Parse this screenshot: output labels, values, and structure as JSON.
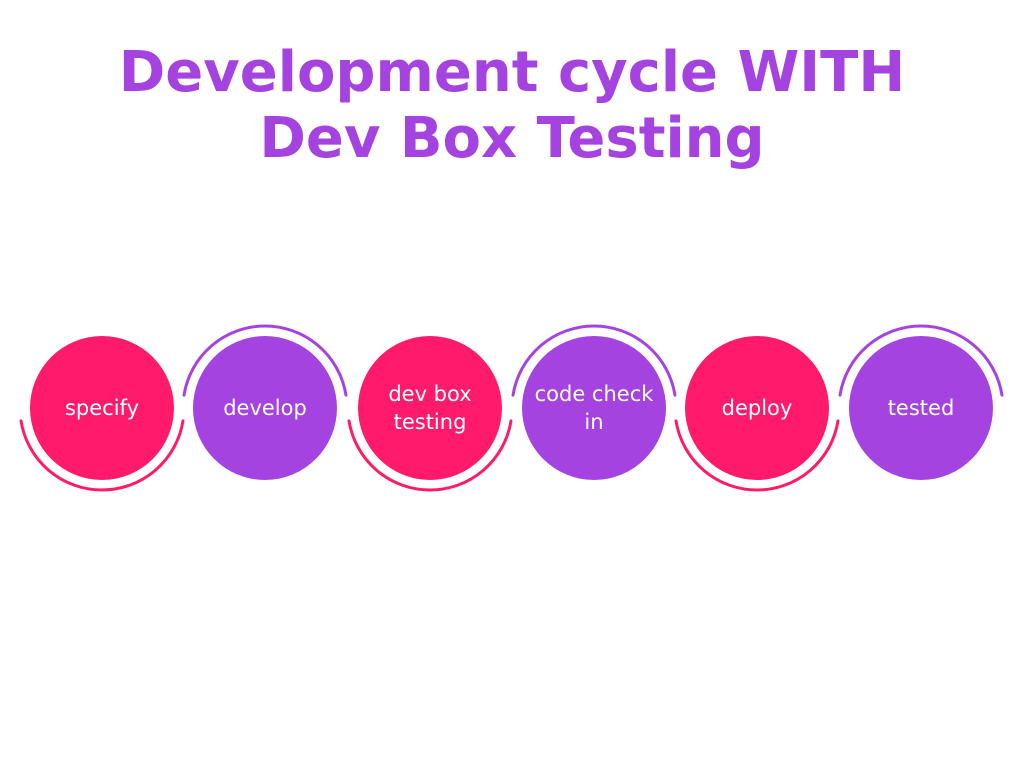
{
  "title": {
    "line1": "Development cycle WITH",
    "line2": "Dev Box Testing"
  },
  "colors": {
    "title": "#a443e0",
    "pink": "#ff1a6b",
    "purple": "#a443e0",
    "white": "#ffffff"
  },
  "steps": [
    {
      "lines": [
        "specify"
      ],
      "color": "pink"
    },
    {
      "lines": [
        "develop"
      ],
      "color": "purple"
    },
    {
      "lines": [
        "dev box",
        "testing"
      ],
      "color": "pink"
    },
    {
      "lines": [
        "code check",
        "in"
      ],
      "color": "purple"
    },
    {
      "lines": [
        "deploy"
      ],
      "color": "pink"
    },
    {
      "lines": [
        "tested"
      ],
      "color": "purple"
    }
  ]
}
